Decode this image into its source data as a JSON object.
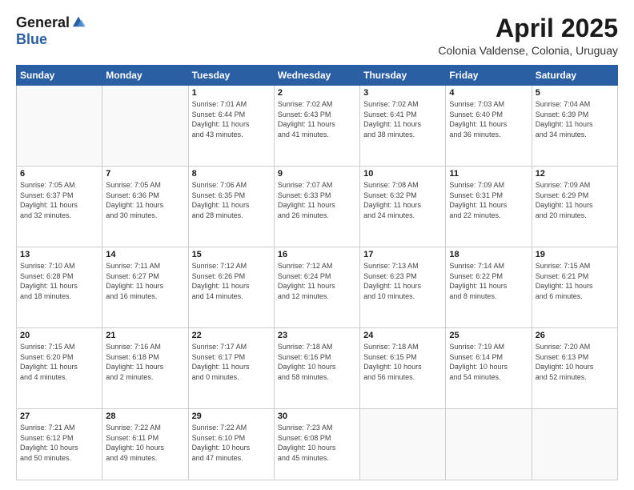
{
  "header": {
    "logo_general": "General",
    "logo_blue": "Blue",
    "month_title": "April 2025",
    "subtitle": "Colonia Valdense, Colonia, Uruguay"
  },
  "columns": [
    "Sunday",
    "Monday",
    "Tuesday",
    "Wednesday",
    "Thursday",
    "Friday",
    "Saturday"
  ],
  "weeks": [
    [
      {
        "day": "",
        "info": ""
      },
      {
        "day": "",
        "info": ""
      },
      {
        "day": "1",
        "info": "Sunrise: 7:01 AM\nSunset: 6:44 PM\nDaylight: 11 hours\nand 43 minutes."
      },
      {
        "day": "2",
        "info": "Sunrise: 7:02 AM\nSunset: 6:43 PM\nDaylight: 11 hours\nand 41 minutes."
      },
      {
        "day": "3",
        "info": "Sunrise: 7:02 AM\nSunset: 6:41 PM\nDaylight: 11 hours\nand 38 minutes."
      },
      {
        "day": "4",
        "info": "Sunrise: 7:03 AM\nSunset: 6:40 PM\nDaylight: 11 hours\nand 36 minutes."
      },
      {
        "day": "5",
        "info": "Sunrise: 7:04 AM\nSunset: 6:39 PM\nDaylight: 11 hours\nand 34 minutes."
      }
    ],
    [
      {
        "day": "6",
        "info": "Sunrise: 7:05 AM\nSunset: 6:37 PM\nDaylight: 11 hours\nand 32 minutes."
      },
      {
        "day": "7",
        "info": "Sunrise: 7:05 AM\nSunset: 6:36 PM\nDaylight: 11 hours\nand 30 minutes."
      },
      {
        "day": "8",
        "info": "Sunrise: 7:06 AM\nSunset: 6:35 PM\nDaylight: 11 hours\nand 28 minutes."
      },
      {
        "day": "9",
        "info": "Sunrise: 7:07 AM\nSunset: 6:33 PM\nDaylight: 11 hours\nand 26 minutes."
      },
      {
        "day": "10",
        "info": "Sunrise: 7:08 AM\nSunset: 6:32 PM\nDaylight: 11 hours\nand 24 minutes."
      },
      {
        "day": "11",
        "info": "Sunrise: 7:09 AM\nSunset: 6:31 PM\nDaylight: 11 hours\nand 22 minutes."
      },
      {
        "day": "12",
        "info": "Sunrise: 7:09 AM\nSunset: 6:29 PM\nDaylight: 11 hours\nand 20 minutes."
      }
    ],
    [
      {
        "day": "13",
        "info": "Sunrise: 7:10 AM\nSunset: 6:28 PM\nDaylight: 11 hours\nand 18 minutes."
      },
      {
        "day": "14",
        "info": "Sunrise: 7:11 AM\nSunset: 6:27 PM\nDaylight: 11 hours\nand 16 minutes."
      },
      {
        "day": "15",
        "info": "Sunrise: 7:12 AM\nSunset: 6:26 PM\nDaylight: 11 hours\nand 14 minutes."
      },
      {
        "day": "16",
        "info": "Sunrise: 7:12 AM\nSunset: 6:24 PM\nDaylight: 11 hours\nand 12 minutes."
      },
      {
        "day": "17",
        "info": "Sunrise: 7:13 AM\nSunset: 6:23 PM\nDaylight: 11 hours\nand 10 minutes."
      },
      {
        "day": "18",
        "info": "Sunrise: 7:14 AM\nSunset: 6:22 PM\nDaylight: 11 hours\nand 8 minutes."
      },
      {
        "day": "19",
        "info": "Sunrise: 7:15 AM\nSunset: 6:21 PM\nDaylight: 11 hours\nand 6 minutes."
      }
    ],
    [
      {
        "day": "20",
        "info": "Sunrise: 7:15 AM\nSunset: 6:20 PM\nDaylight: 11 hours\nand 4 minutes."
      },
      {
        "day": "21",
        "info": "Sunrise: 7:16 AM\nSunset: 6:18 PM\nDaylight: 11 hours\nand 2 minutes."
      },
      {
        "day": "22",
        "info": "Sunrise: 7:17 AM\nSunset: 6:17 PM\nDaylight: 11 hours\nand 0 minutes."
      },
      {
        "day": "23",
        "info": "Sunrise: 7:18 AM\nSunset: 6:16 PM\nDaylight: 10 hours\nand 58 minutes."
      },
      {
        "day": "24",
        "info": "Sunrise: 7:18 AM\nSunset: 6:15 PM\nDaylight: 10 hours\nand 56 minutes."
      },
      {
        "day": "25",
        "info": "Sunrise: 7:19 AM\nSunset: 6:14 PM\nDaylight: 10 hours\nand 54 minutes."
      },
      {
        "day": "26",
        "info": "Sunrise: 7:20 AM\nSunset: 6:13 PM\nDaylight: 10 hours\nand 52 minutes."
      }
    ],
    [
      {
        "day": "27",
        "info": "Sunrise: 7:21 AM\nSunset: 6:12 PM\nDaylight: 10 hours\nand 50 minutes."
      },
      {
        "day": "28",
        "info": "Sunrise: 7:22 AM\nSunset: 6:11 PM\nDaylight: 10 hours\nand 49 minutes."
      },
      {
        "day": "29",
        "info": "Sunrise: 7:22 AM\nSunset: 6:10 PM\nDaylight: 10 hours\nand 47 minutes."
      },
      {
        "day": "30",
        "info": "Sunrise: 7:23 AM\nSunset: 6:08 PM\nDaylight: 10 hours\nand 45 minutes."
      },
      {
        "day": "",
        "info": ""
      },
      {
        "day": "",
        "info": ""
      },
      {
        "day": "",
        "info": ""
      }
    ]
  ]
}
